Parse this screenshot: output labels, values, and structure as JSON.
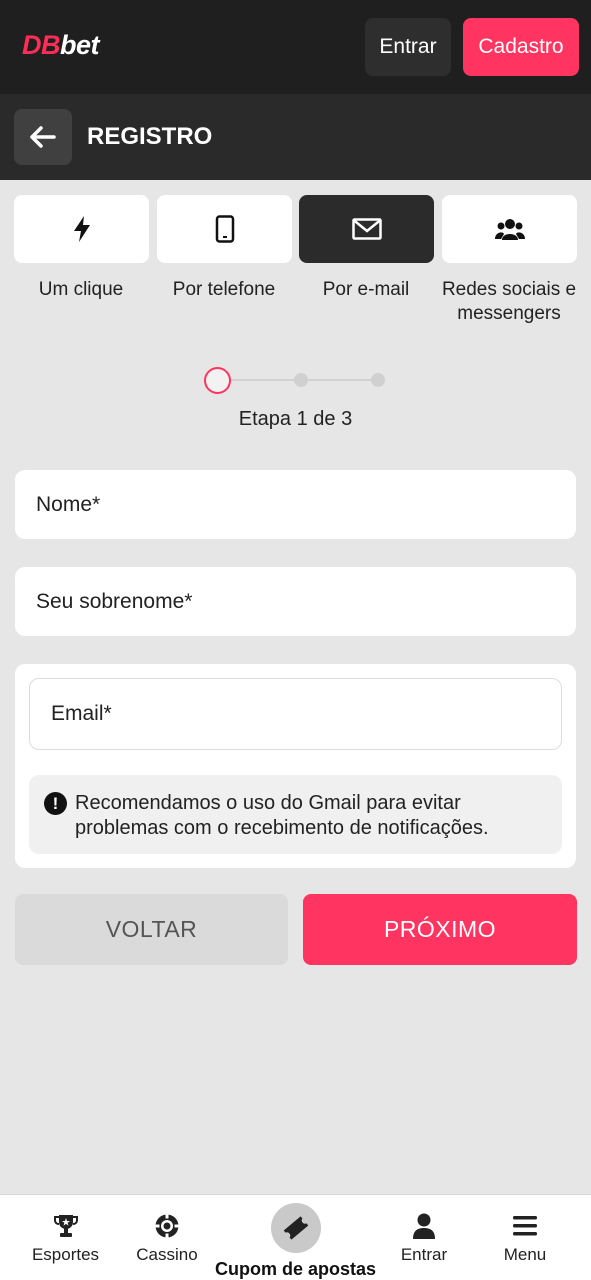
{
  "header": {
    "logo_db": "DB",
    "logo_bet": "bet",
    "login_label": "Entrar",
    "register_label": "Cadastro"
  },
  "subheader": {
    "title": "REGISTRO"
  },
  "methods": [
    {
      "label": "Um clique",
      "icon": "lightning-icon",
      "active": false
    },
    {
      "label": "Por telefone",
      "icon": "phone-icon",
      "active": false
    },
    {
      "label": "Por e-mail",
      "icon": "envelope-icon",
      "active": true
    },
    {
      "label": "Redes sociais e messengers",
      "icon": "users-icon",
      "active": false
    }
  ],
  "stepper": {
    "text": "Etapa 1 de 3",
    "current": 1,
    "total": 3
  },
  "form": {
    "first_name_placeholder": "Nome*",
    "last_name_placeholder": "Seu sobrenome*",
    "email_placeholder": "Email*",
    "notice": "Recomendamos o uso do Gmail para evitar problemas com o recebimento de notificações."
  },
  "actions": {
    "back_label": "VOLTAR",
    "next_label": "PRÓXIMO"
  },
  "bottom_nav": [
    {
      "label": "Esportes",
      "icon": "trophy-icon"
    },
    {
      "label": "Cassino",
      "icon": "casino-chip-icon"
    },
    {
      "label": "Cupom de apostas",
      "icon": "ticket-icon"
    },
    {
      "label": "Entrar",
      "icon": "user-icon"
    },
    {
      "label": "Menu",
      "icon": "hamburger-menu-icon"
    }
  ],
  "colors": {
    "accent": "#ff3460",
    "header_bg": "#1f1f1f",
    "page_bg": "#e6e6e6"
  }
}
